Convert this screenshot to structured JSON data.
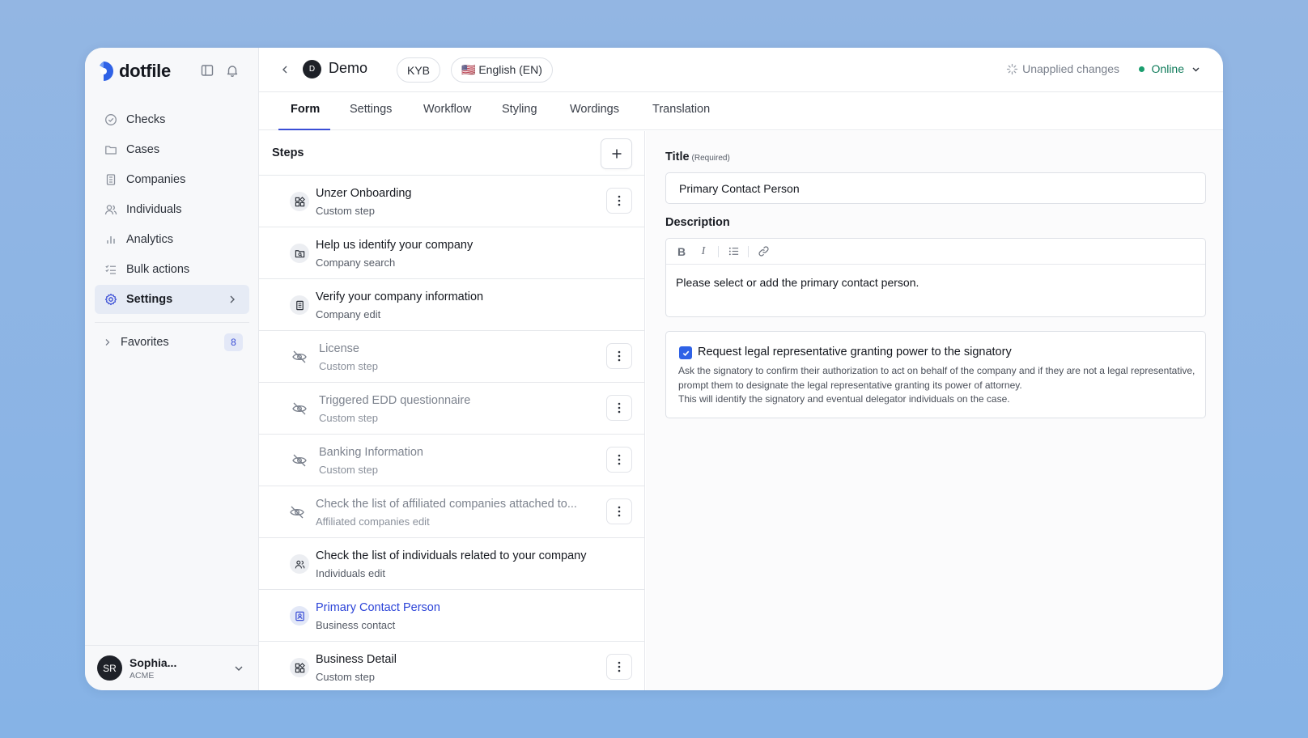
{
  "brand": {
    "name": "dotfile"
  },
  "sidebar": {
    "items": [
      {
        "label": "Checks",
        "icon": "check-circle-icon"
      },
      {
        "label": "Cases",
        "icon": "folder-icon"
      },
      {
        "label": "Companies",
        "icon": "building-icon"
      },
      {
        "label": "Individuals",
        "icon": "users-icon"
      },
      {
        "label": "Analytics",
        "icon": "bar-chart-icon"
      },
      {
        "label": "Bulk actions",
        "icon": "list-check-icon"
      },
      {
        "label": "Settings",
        "icon": "gear-icon",
        "active": true
      }
    ],
    "favorites": {
      "label": "Favorites",
      "count": "8"
    },
    "user": {
      "initials": "SR",
      "name": "Sophia...",
      "org": "ACME"
    }
  },
  "topbar": {
    "avatar_initial": "D",
    "title": "Demo",
    "pill_kyb": "KYB",
    "pill_lang": "🇺🇸 English (EN)",
    "unapplied": "Unapplied changes",
    "status": "Online"
  },
  "tabs": [
    "Form",
    "Settings",
    "Workflow",
    "Styling",
    "Wordings",
    "Translation"
  ],
  "steps": {
    "title": "Steps",
    "list": [
      {
        "title": "Unzer Onboarding",
        "subtitle": "Custom step"
      },
      {
        "title": "Help us identify your company",
        "subtitle": "Company search"
      },
      {
        "title": "Verify your company information",
        "subtitle": "Company edit"
      },
      {
        "title": "License",
        "subtitle": "Custom step"
      },
      {
        "title": "Triggered EDD questionnaire",
        "subtitle": "Custom step"
      },
      {
        "title": "Banking Information",
        "subtitle": "Custom step"
      },
      {
        "title": "Check the list of affiliated companies attached to...",
        "subtitle": "Affiliated companies edit"
      },
      {
        "title": "Check the list of individuals related to your company",
        "subtitle": "Individuals edit"
      },
      {
        "title": "Primary Contact Person",
        "subtitle": "Business contact"
      },
      {
        "title": "Business Detail",
        "subtitle": "Custom step"
      }
    ]
  },
  "detail": {
    "title_label": "Title",
    "title_required": "(Required)",
    "title_value": "Primary Contact Person",
    "description_label": "Description",
    "description_value": "Please select or add the primary contact person.",
    "toolbar": {
      "bold": "B",
      "italic": "I"
    },
    "checkbox_title": "Request legal representative granting power to the signatory",
    "checkbox_desc_1": "Ask the signatory to confirm their authorization to act on behalf of the company and if they are not a legal representative, prompt them to designate the legal representative granting its power of attorney.",
    "checkbox_desc_2": "This will identify the signatory and eventual delegator individuals on the case."
  },
  "colors": {
    "accent": "#3a4ed6",
    "online": "#1a9e6e",
    "background": "#8fb5e2"
  }
}
